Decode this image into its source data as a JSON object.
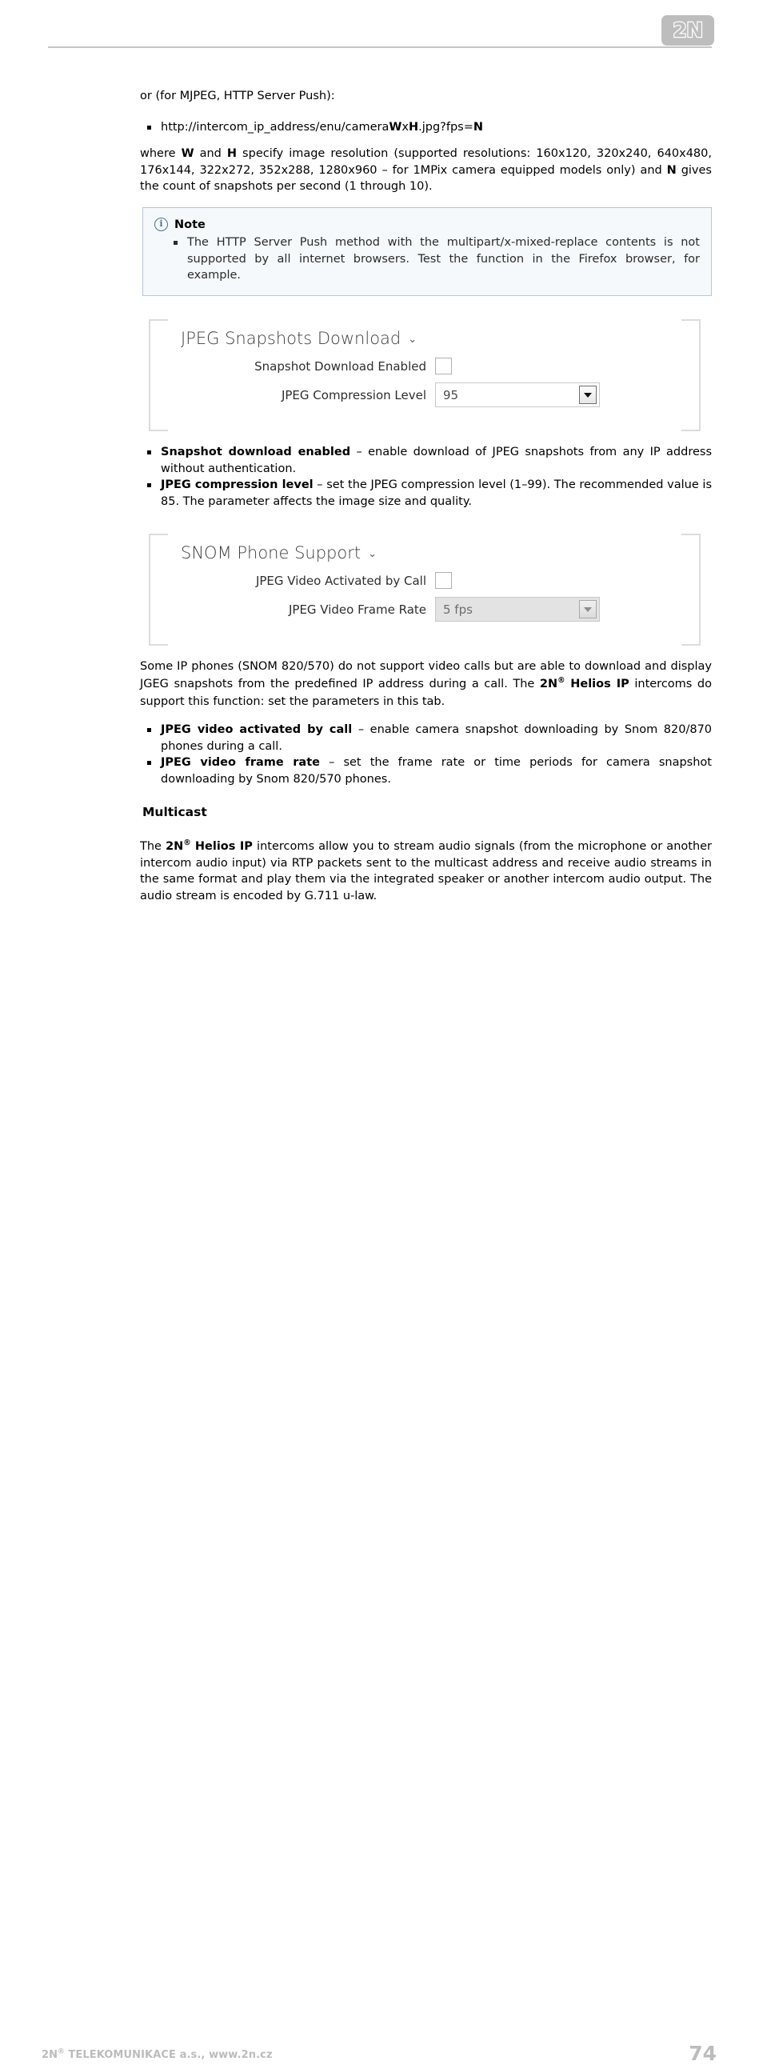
{
  "header": {
    "logo_text": "2N",
    "logo_color": "#bdbdbd"
  },
  "intro": {
    "lead": "or (for MJPEG, HTTP Server Push):",
    "url_bullet": {
      "prefix": "http://intercom_ip_address/enu/camera",
      "w": "W",
      "x": "x",
      "h": "H",
      "suffix": ".jpg?fps=",
      "n": "N"
    },
    "paragraph_part1": "where ",
    "paragraph_w": "W",
    "paragraph_part2": " and ",
    "paragraph_h": "H",
    "paragraph_part3": " specify image resolution (supported resolutions: 160x120, 320x240, 640x480, 176x144, 322x272, 352x288, 1280x960 – for 1MPix camera equipped models only) and ",
    "paragraph_n": "N",
    "paragraph_part4": " gives the count of snapshots per second (1 through 10)."
  },
  "note": {
    "icon": "info-icon",
    "title": "Note",
    "items": [
      "The HTTP Server Push method with the multipart/x-mixed-replace contents is not supported by all internet browsers. Test the function in the Firefox browser, for example."
    ]
  },
  "jpeg_snapshots_panel": {
    "title": "JPEG Snapshots Download",
    "chevron": "⌄",
    "rows": [
      {
        "label": "Snapshot Download Enabled",
        "type": "checkbox",
        "checked": false
      },
      {
        "label": "JPEG Compression Level",
        "type": "select",
        "value": "95",
        "disabled": false
      }
    ]
  },
  "jpeg_bullets": [
    {
      "term": "Snapshot download enabled",
      "dash": " – ",
      "text": "enable download of JPEG snapshots from any IP address without authentication."
    },
    {
      "term": "JPEG compression level",
      "dash": " – ",
      "text": "set the JPEG compression level (1–99). The recommended value is 85. The parameter affects the image size and quality."
    }
  ],
  "snom_panel": {
    "title": "SNOM Phone Support",
    "chevron": "⌄",
    "rows": [
      {
        "label": "JPEG Video Activated by Call",
        "type": "checkbox",
        "checked": false
      },
      {
        "label": "JPEG Video Frame Rate",
        "type": "select",
        "value": "5 fps",
        "disabled": true
      }
    ]
  },
  "snom_paragraph": {
    "part1": "Some IP phones (SNOM 820/570) do not support video calls but are able to download and display JGEG snapshots from the predefined IP address during a call. The ",
    "brand": "2N",
    "reg": "®",
    "brand2": "Helios IP",
    "part2": " intercoms do support this function: set the parameters in this tab."
  },
  "snom_bullets": [
    {
      "term": "JPEG video activated by call",
      "dash": " – ",
      "text": "enable camera snapshot downloading by Snom 820/870 phones during a call."
    },
    {
      "term": "JPEG video frame rate",
      "dash": " – ",
      "text": "set the frame rate or time periods for camera snapshot downloading by Snom 820/570 phones."
    }
  ],
  "multicast": {
    "heading": "Multicast",
    "paragraph_part1": "The ",
    "brand": "2N",
    "reg": "®",
    "brand2": "Helios IP",
    "paragraph_part2": " intercoms allow you to stream audio signals (from the microphone or another intercom audio input) via RTP packets sent to the multicast address and receive audio streams in the same format and play them via the integrated speaker or another intercom audio output. The audio stream is encoded by G.711 u-law."
  },
  "footer": {
    "company": "2N",
    "company_reg": "®",
    "company_rest": " TELEKOMUNIKACE a.s., www.2n.cz",
    "page_number": "74"
  }
}
